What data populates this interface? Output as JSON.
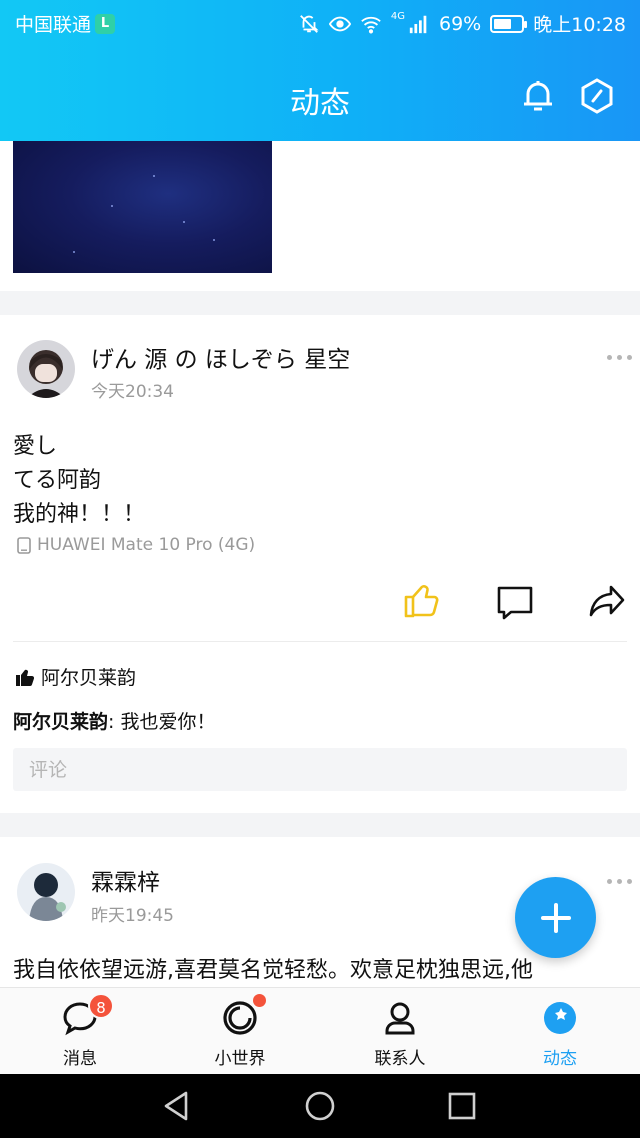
{
  "status_bar": {
    "carrier": "中国联通",
    "carrier_badge": "L",
    "network": "4G",
    "battery": "69%",
    "battery_level": 0.69,
    "time": "晚上10:28"
  },
  "header": {
    "title": "动态",
    "bell_icon": "bell-icon",
    "settings_icon": "hexagon-icon"
  },
  "posts": [
    {
      "username": "げん 源 の ほしぞら 星空",
      "time": "今天20:34",
      "content": [
        "愛し",
        "てる阿韵",
        "我的神！！！"
      ],
      "device": "HUAWEI Mate 10 Pro (4G)",
      "liked_by": "阿尔贝莱韵",
      "comments": [
        {
          "author": "阿尔贝莱韵",
          "separator": ": ",
          "text": "我也爱你！"
        }
      ],
      "comment_placeholder": "评论"
    },
    {
      "username": "霖霖梓",
      "time": "昨天19:45",
      "content": [
        "我自依依望远游,喜君莫名觉轻愁。欢意足枕独思远,他"
      ]
    }
  ],
  "tabs": [
    {
      "label": "消息",
      "icon": "message-bubble-icon",
      "badge": "8",
      "active": false
    },
    {
      "label": "小世界",
      "icon": "small-world-icon",
      "dot": true,
      "active": false
    },
    {
      "label": "联系人",
      "icon": "contact-person-icon",
      "active": false
    },
    {
      "label": "动态",
      "icon": "star-planet-icon",
      "active": true
    }
  ],
  "colors": {
    "header_start": "#12c8f5",
    "header_end": "#1996f6",
    "accent": "#1ea0f2",
    "like_active": "#f1c21a",
    "badge": "#f4533b"
  }
}
